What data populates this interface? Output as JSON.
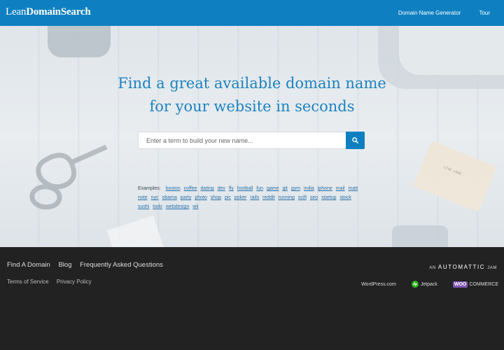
{
  "header": {
    "logo_light": "Lean",
    "logo_bold": "DomainSearch",
    "nav": [
      {
        "label": "Domain Name Generator"
      },
      {
        "label": "Tour"
      }
    ]
  },
  "hero": {
    "headline_line1": "Find a great available domain name",
    "headline_line2": "for your website in seconds",
    "card_text": "LIVE LOVE",
    "search": {
      "placeholder": "Enter a term to build your new name...",
      "button_icon": "search-icon"
    },
    "examples_label": "Examples:",
    "examples": [
      "boston",
      "coffee",
      "dating",
      "dev",
      "fly",
      "football",
      "fun",
      "game",
      "git",
      "gym",
      "india",
      "iphone",
      "mail",
      "matt",
      "note",
      "nyc",
      "obama",
      "party",
      "photo",
      "shop",
      "pic",
      "poker",
      "rails",
      "reddit",
      "running",
      "scifi",
      "seo",
      "startup",
      "stock",
      "sushi",
      "todo",
      "webdesign",
      "wii"
    ]
  },
  "footer": {
    "links": [
      "Find A Domain",
      "Blog",
      "Frequently Asked Questions"
    ],
    "sub_links": [
      "Terms of Service",
      "Privacy Policy"
    ],
    "jam_prefix": "AN",
    "jam_brand": "AUTOMATTIC",
    "jam_suffix": "JAM",
    "brands": {
      "wordpress": "WordPress.com",
      "jetpack": "Jetpack",
      "woo_badge": "WOO",
      "woo_text": "COMMERCE"
    }
  },
  "colors": {
    "header_blue": "#0e80c1",
    "headline_blue": "#1d82c0",
    "footer_bg": "#222222",
    "jetpack_green": "#2fb41f",
    "woo_purple": "#7f54b3"
  }
}
